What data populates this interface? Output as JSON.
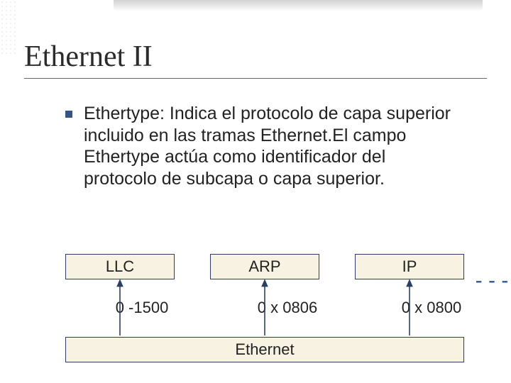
{
  "title": "Ethernet II",
  "bullet_text": "Ethertype: Indica el protocolo de capa superior incluido en las tramas Ethernet.El campo Ethertype actúa como identificador del protocolo de subcapa o capa superior.",
  "diagram": {
    "top_boxes": {
      "llc": "LLC",
      "arp": "ARP",
      "ip": "IP"
    },
    "labels": {
      "n0_1500": "0 -1500",
      "n0x0806": "0 x 0806",
      "n0x0800": "0 x 0800"
    },
    "bottom_box": "Ethernet",
    "ellipsis": "- - -"
  }
}
